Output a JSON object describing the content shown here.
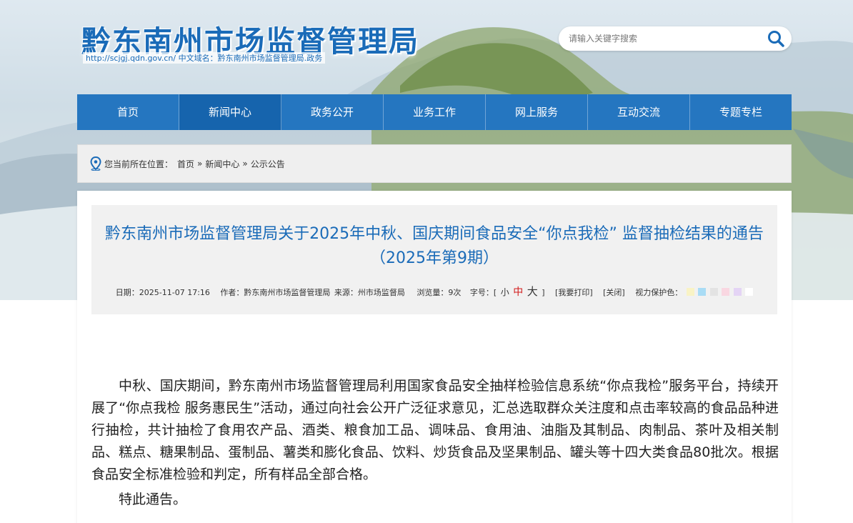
{
  "site": {
    "title": "黔东南州市场监督管理局",
    "domain_line": "http://scjgj.qdn.gov.cn/  中文域名：黔东南州市场监督管理局.政务"
  },
  "search": {
    "placeholder": "请输入关键字搜索"
  },
  "nav": {
    "items": [
      {
        "label": "首页"
      },
      {
        "label": "新闻中心"
      },
      {
        "label": "政务公开"
      },
      {
        "label": "业务工作"
      },
      {
        "label": "网上服务"
      },
      {
        "label": "互动交流"
      },
      {
        "label": "专题专栏"
      }
    ]
  },
  "breadcrumb": {
    "prefix": "您当前所在位置：",
    "items": [
      "首页",
      "新闻中心",
      "公示公告"
    ],
    "separator": "»"
  },
  "article": {
    "title": "黔东南州市场监督管理局关于2025年中秋、国庆期间食品安全“你点我检” 监督抽检结果的通告（2025年第9期）",
    "meta": {
      "date": "日期：2025-11-07 17:16",
      "author": "作者：黔东南州市场监督管理局",
      "source": "来源：州市场监督局",
      "views": "浏览量：9次",
      "font_label": "字号：[",
      "font_small": "小",
      "font_mid": "中",
      "font_big": "大",
      "font_end": "]",
      "print": "[我要打印]",
      "close": "[关闭]",
      "eye_label": "视力保护色："
    },
    "eye_colors": [
      "#f9f3c5",
      "#a9dcf5",
      "#e3e3e3",
      "#f9d7e1",
      "#e4d4f5",
      "#ffffff"
    ],
    "paragraphs": [
      "中秋、国庆期间，黔东南州市场监督管理局利用国家食品安全抽样检验信息系统“你点我检”服务平台，持续开展了“你点我检 服务惠民生”活动，通过向社会公开广泛征求意见，汇总选取群众关注度和点击率较高的食品品种进行抽检，共计抽检了食用农产品、酒类、粮食加工品、调味品、食用油、油脂及其制品、肉制品、茶叶及相关制品、糕点、糖果制品、蛋制品、薯类和膨化食品、饮料、炒货食品及坚果制品、罐头等十四大类食品80批次。根据食品安全标准检验和判定，所有样品全部合格。",
      "特此通告。"
    ]
  },
  "colors": {
    "brand_blue": "#2576c0",
    "title_blue": "#1a6bb8",
    "accent_red": "#d21b1b"
  },
  "icons": {
    "search": "search-icon",
    "location": "location-pin-icon"
  }
}
